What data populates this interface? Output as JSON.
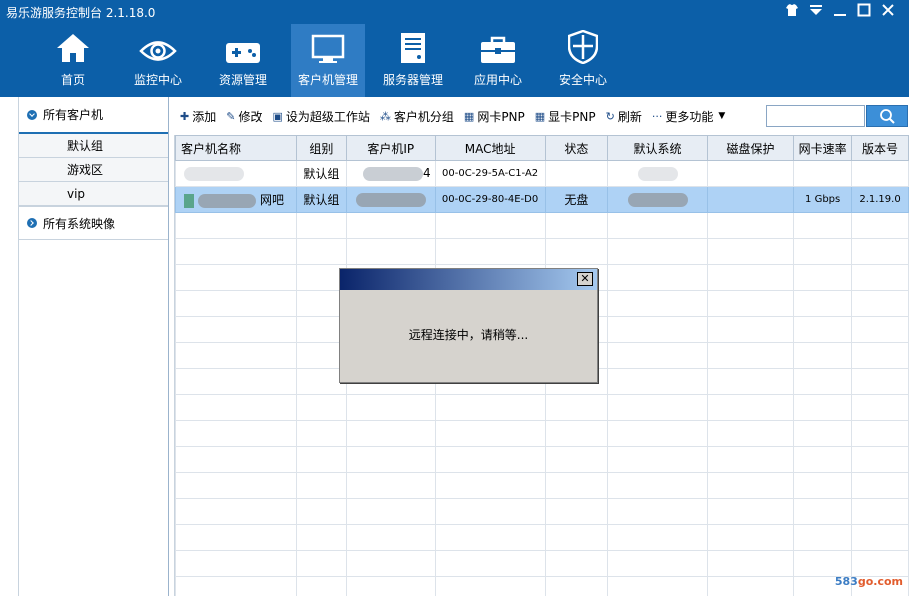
{
  "app": {
    "title": "易乐游服务控制台 2.1.18.0"
  },
  "nav": [
    {
      "label": "首页",
      "icon": "home-icon"
    },
    {
      "label": "监控中心",
      "icon": "eye-icon"
    },
    {
      "label": "资源管理",
      "icon": "gamepad-icon"
    },
    {
      "label": "客户机管理",
      "icon": "monitor-icon",
      "active": true
    },
    {
      "label": "服务器管理",
      "icon": "server-icon"
    },
    {
      "label": "应用中心",
      "icon": "toolbox-icon"
    },
    {
      "label": "安全中心",
      "icon": "shield-icon"
    }
  ],
  "sidebar": {
    "root1": "所有客户机",
    "groups": [
      "默认组",
      "游戏区",
      "vip"
    ],
    "root2": "所有系统映像"
  },
  "toolbar": {
    "add": "添加",
    "edit": "修改",
    "set_super": "设为超级工作站",
    "group": "客户机分组",
    "nic_pnp": "网卡PNP",
    "gpu_pnp": "显卡PNP",
    "refresh": "刷新",
    "more": "更多功能",
    "search_placeholder": ""
  },
  "table": {
    "columns": [
      "客户机名称",
      "组别",
      "客户机IP",
      "MAC地址",
      "状态",
      "默认系统",
      "磁盘保护",
      "网卡速率",
      "版本号"
    ],
    "rows": [
      {
        "name": "",
        "group": "默认组",
        "ip_suffix": "4",
        "mac": "00-0C-29-5A-C1-A2",
        "status": "",
        "system": "",
        "protect": "",
        "speed": "",
        "version": ""
      },
      {
        "name": "网吧",
        "group": "默认组",
        "ip_suffix": "",
        "mac": "00-0C-29-80-4E-D0",
        "status": "无盘",
        "system": "",
        "protect": "",
        "speed": "1 Gbps",
        "version": "2.1.19.0"
      }
    ]
  },
  "dialog": {
    "message": "远程连接中，请稍等...",
    "close": "✕"
  },
  "watermark": {
    "num": "583",
    "rest": "go.com"
  }
}
